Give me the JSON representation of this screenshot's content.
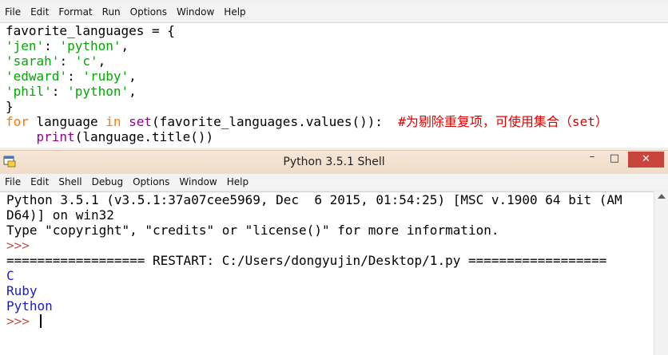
{
  "editor": {
    "menu": [
      "File",
      "Edit",
      "Format",
      "Run",
      "Options",
      "Window",
      "Help"
    ],
    "lines": [
      {
        "segments": [
          {
            "t": "favorite_languages = {",
            "c": ""
          }
        ]
      },
      {
        "segments": [
          {
            "t": "'jen'",
            "c": "str"
          },
          {
            "t": ": ",
            "c": ""
          },
          {
            "t": "'python'",
            "c": "str"
          },
          {
            "t": ",",
            "c": ""
          }
        ]
      },
      {
        "segments": [
          {
            "t": "'sarah'",
            "c": "str"
          },
          {
            "t": ": ",
            "c": ""
          },
          {
            "t": "'c'",
            "c": "str"
          },
          {
            "t": ",",
            "c": ""
          }
        ]
      },
      {
        "segments": [
          {
            "t": "'edward'",
            "c": "str"
          },
          {
            "t": ": ",
            "c": ""
          },
          {
            "t": "'ruby'",
            "c": "str"
          },
          {
            "t": ",",
            "c": ""
          }
        ]
      },
      {
        "segments": [
          {
            "t": "'phil'",
            "c": "str"
          },
          {
            "t": ": ",
            "c": ""
          },
          {
            "t": "'python'",
            "c": "str"
          },
          {
            "t": ",",
            "c": ""
          }
        ]
      },
      {
        "segments": [
          {
            "t": "}",
            "c": ""
          }
        ]
      },
      {
        "segments": [
          {
            "t": "for",
            "c": "kw"
          },
          {
            "t": " language ",
            "c": ""
          },
          {
            "t": "in",
            "c": "kw"
          },
          {
            "t": " ",
            "c": ""
          },
          {
            "t": "set",
            "c": "bi"
          },
          {
            "t": "(favorite_languages.values()):  ",
            "c": ""
          },
          {
            "t": "#为剔除重复项，可使用集合（set）",
            "c": "cm"
          }
        ]
      },
      {
        "segments": [
          {
            "t": "    ",
            "c": ""
          },
          {
            "t": "print",
            "c": "bi"
          },
          {
            "t": "(language.title())",
            "c": ""
          }
        ]
      }
    ]
  },
  "shell": {
    "title": "Python 3.5.1 Shell",
    "window_buttons": {
      "minimize": "–",
      "maximize": "□",
      "close": "✕"
    },
    "menu": [
      "File",
      "Edit",
      "Shell",
      "Debug",
      "Options",
      "Window",
      "Help"
    ],
    "lines": [
      {
        "t": "Python 3.5.1 (v3.5.1:37a07cee5969, Dec  6 2015, 01:54:25) [MSC v.1900 64 bit (AM",
        "c": ""
      },
      {
        "t": "D64)] on win32",
        "c": ""
      },
      {
        "t": "Type \"copyright\", \"credits\" or \"license()\" for more information.",
        "c": ""
      },
      {
        "t": ">>> ",
        "c": "prompt"
      },
      {
        "t": "================== RESTART: C:/Users/dongyujin/Desktop/1.py ==================",
        "c": ""
      },
      {
        "t": "C",
        "c": "out"
      },
      {
        "t": "Ruby",
        "c": "out"
      },
      {
        "t": "Python",
        "c": "out"
      }
    ],
    "final_prompt": ">>> "
  },
  "icons": {
    "app": "python-shell-icon",
    "scroll_up": "scroll-up-arrow-icon"
  }
}
